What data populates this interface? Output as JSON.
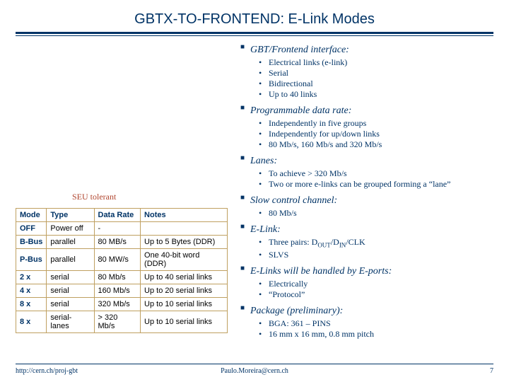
{
  "title": "GBTX-TO-FRONTEND: E-Link Modes",
  "seu_label": "SEU tolerant",
  "table": {
    "headers": [
      "Mode",
      "Type",
      "Data Rate",
      "Notes"
    ],
    "rows": [
      [
        "OFF",
        "Power off",
        "-",
        ""
      ],
      [
        "B-Bus",
        "parallel",
        "80 MB/s",
        "Up to 5 Bytes (DDR)"
      ],
      [
        "P-Bus",
        "parallel",
        "80 MW/s",
        "One 40-bit word (DDR)"
      ],
      [
        "2 x",
        "serial",
        "80 Mb/s",
        "Up to 40 serial links"
      ],
      [
        "4 x",
        "serial",
        "160 Mb/s",
        "Up to 20 serial links"
      ],
      [
        "8 x",
        "serial",
        "320 Mb/s",
        "Up to 10 serial links"
      ],
      [
        "8 x",
        "serial-lanes",
        "> 320 Mb/s",
        "Up to 10 serial links"
      ]
    ]
  },
  "sections": [
    {
      "title": "GBT/Frontend interface:",
      "items": [
        "Electrical links (e-link)",
        "Serial",
        "Bidirectional",
        "Up to 40 links"
      ]
    },
    {
      "title": "Programmable data rate:",
      "items": [
        "Independently in five groups",
        "Independently for up/down links",
        "80 Mb/s, 160 Mb/s and 320 Mb/s"
      ]
    },
    {
      "title": "Lanes:",
      "items": [
        "To achieve > 320 Mb/s",
        "Two or more e-links can be grouped forming a “lane”"
      ]
    },
    {
      "title": "Slow control channel:",
      "items": [
        "80 Mb/s"
      ]
    },
    {
      "title": "E-Link:",
      "items": [
        "Three pairs: Dₒᵤₜ/Dₗₙ/CLK",
        "SLVS"
      ],
      "raw_html_idx": 0
    },
    {
      "title": "E-Links will be handled by E-ports:",
      "items": [
        "Electrically",
        "“Protocol”"
      ]
    },
    {
      "title": "Package (preliminary):",
      "items": [
        "BGA: 361 – PINS",
        "16 mm x 16 mm, 0.8 mm pitch"
      ]
    }
  ],
  "footer": {
    "left": "http://cern.ch/proj-gbt",
    "center": "Paulo.Moreira@cern.ch",
    "page": "7"
  }
}
